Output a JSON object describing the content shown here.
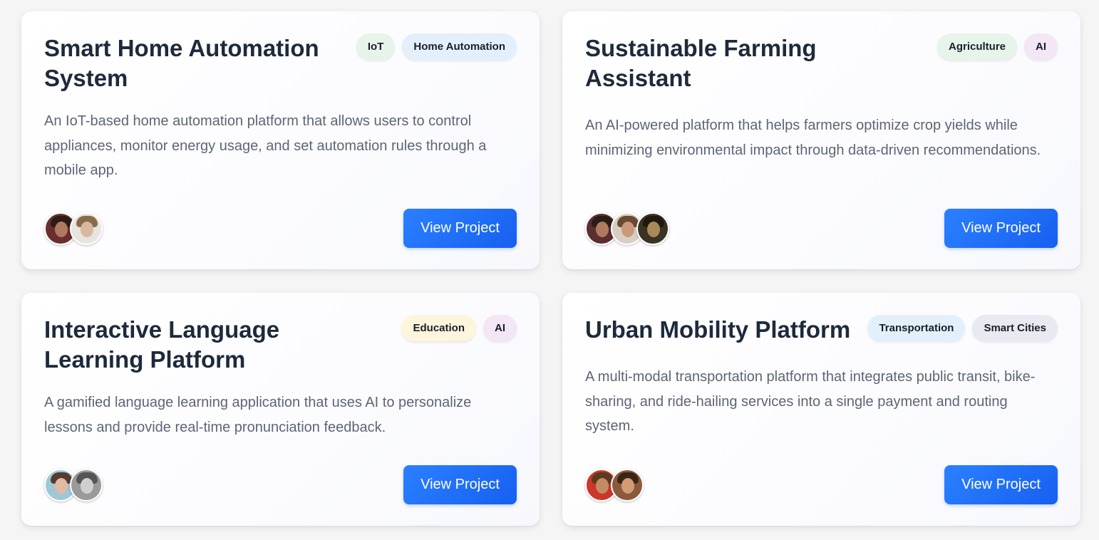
{
  "projects": [
    {
      "title": "Smart Home Automation System",
      "tags": [
        {
          "label": "IoT",
          "color": "#e7f4ea"
        },
        {
          "label": "Home Automation",
          "color": "#e3f0fb"
        }
      ],
      "description": "An IoT-based home automation platform that allows users to control appliances, monitor energy usage, and set automation rules through a mobile app.",
      "avatars": [
        {
          "bg": "#6b2e2e",
          "skin": "#b07a5e",
          "hair": "#2a1c17"
        },
        {
          "bg": "#e8e4df",
          "skin": "#d9b8a0",
          "hair": "#8a6a4a"
        }
      ],
      "button": "View Project"
    },
    {
      "title": "Sustainable Farming Assistant",
      "tags": [
        {
          "label": "Agriculture",
          "color": "#e7f4ea"
        },
        {
          "label": "AI",
          "color": "#f3e6f5"
        }
      ],
      "description": "An AI-powered platform that helps farmers optimize crop yields while minimizing environmental impact through data-driven recommendations.",
      "avatars": [
        {
          "bg": "#5a2f2f",
          "skin": "#b07a5e",
          "hair": "#2a1c17"
        },
        {
          "bg": "#d8cfc4",
          "skin": "#c89a7a",
          "hair": "#6b4a33"
        },
        {
          "bg": "#3a3323",
          "skin": "#a88a5a",
          "hair": "#1e1a10"
        }
      ],
      "button": "View Project"
    },
    {
      "title": "Interactive Language Learning Platform",
      "tags": [
        {
          "label": "Education",
          "color": "#fdf5dc"
        },
        {
          "label": "AI",
          "color": "#f3e6f5"
        }
      ],
      "description": "A gamified language learning application that uses AI to personalize lessons and provide real-time pronunciation feedback.",
      "avatars": [
        {
          "bg": "#9ec8d6",
          "skin": "#e2b9a3",
          "hair": "#5a3a2e"
        },
        {
          "bg": "#9a9a9a",
          "skin": "#cfcfcf",
          "hair": "#555555"
        }
      ],
      "button": "View Project"
    },
    {
      "title": "Urban Mobility Platform",
      "tags": [
        {
          "label": "Transportation",
          "color": "#e3f0fb"
        },
        {
          "label": "Smart Cities",
          "color": "#e9e9f2"
        }
      ],
      "description": "A multi-modal transportation platform that integrates public transit, bike-sharing, and ride-hailing services into a single payment and routing system.",
      "avatars": [
        {
          "bg": "#c9382a",
          "skin": "#c48a64",
          "hair": "#5a3a20"
        },
        {
          "bg": "#8a5a3a",
          "skin": "#d39a76",
          "hair": "#3a2418"
        }
      ],
      "button": "View Project"
    }
  ]
}
